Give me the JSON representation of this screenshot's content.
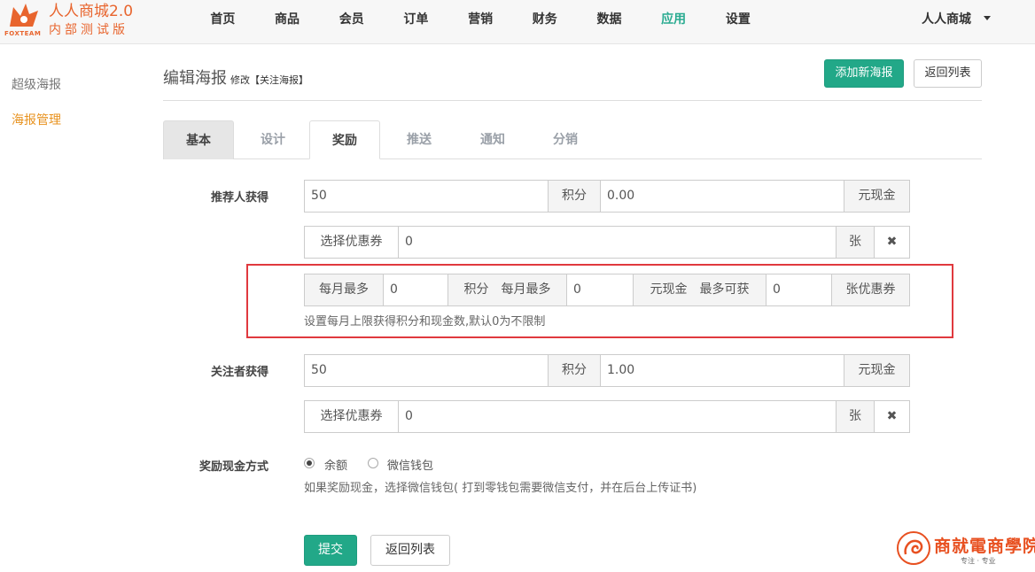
{
  "brand": {
    "title": "人人商城2.0",
    "subtitle": "内部测试版",
    "logo_text": "FOXTEAM",
    "accent_color": "#e8652e"
  },
  "nav": {
    "items": [
      {
        "label": "首页"
      },
      {
        "label": "商品"
      },
      {
        "label": "会员"
      },
      {
        "label": "订单"
      },
      {
        "label": "营销"
      },
      {
        "label": "财务"
      },
      {
        "label": "数据"
      },
      {
        "label": "应用",
        "active": true
      },
      {
        "label": "设置"
      }
    ],
    "user_menu": "人人商城",
    "active_color": "#2aab91"
  },
  "sidebar": {
    "items": [
      {
        "label": "超级海报",
        "active": false
      },
      {
        "label": "海报管理",
        "active": true
      }
    ],
    "active_color": "#e8921e"
  },
  "header": {
    "title": "编辑海报",
    "meta": "修改【关注海报】",
    "add_button": "添加新海报",
    "back_button": "返回列表"
  },
  "tabs": [
    {
      "label": "基本"
    },
    {
      "label": "设计"
    },
    {
      "label": "奖励",
      "active": true
    },
    {
      "label": "推送"
    },
    {
      "label": "通知"
    },
    {
      "label": "分销"
    }
  ],
  "form": {
    "referrer": {
      "label": "推荐人获得",
      "points_value": "50",
      "points_unit": "积分",
      "cash_value": "0.00",
      "cash_unit": "元现金",
      "coupon_button": "选择优惠券",
      "coupon_value": "0",
      "coupon_unit": "张",
      "clear_icon": "close-icon"
    },
    "monthly_limit": {
      "label_points": "每月最多",
      "points_value": "0",
      "label_cash": "积分　每月最多",
      "cash_value": "0",
      "label_coupon": "元现金　最多可获",
      "coupon_value": "0",
      "coupon_unit": "张优惠券",
      "help": "设置每月上限获得积分和现金数,默认0为不限制"
    },
    "follower": {
      "label": "关注者获得",
      "points_value": "50",
      "points_unit": "积分",
      "cash_value": "1.00",
      "cash_unit": "元现金",
      "coupon_button": "选择优惠券",
      "coupon_value": "0",
      "coupon_unit": "张",
      "clear_icon": "close-icon"
    },
    "payout": {
      "label": "奖励现金方式",
      "options": [
        {
          "label": "余额",
          "selected": true
        },
        {
          "label": "微信钱包",
          "selected": false
        }
      ],
      "help": "如果奖励现金，选择微信钱包( 打到零钱包需要微信支付，并在后台上传证书)"
    },
    "submit_button": "提交",
    "back_button": "返回列表"
  },
  "watermark": {
    "title": "商就電商學院",
    "sub": "专注 · 专业"
  }
}
